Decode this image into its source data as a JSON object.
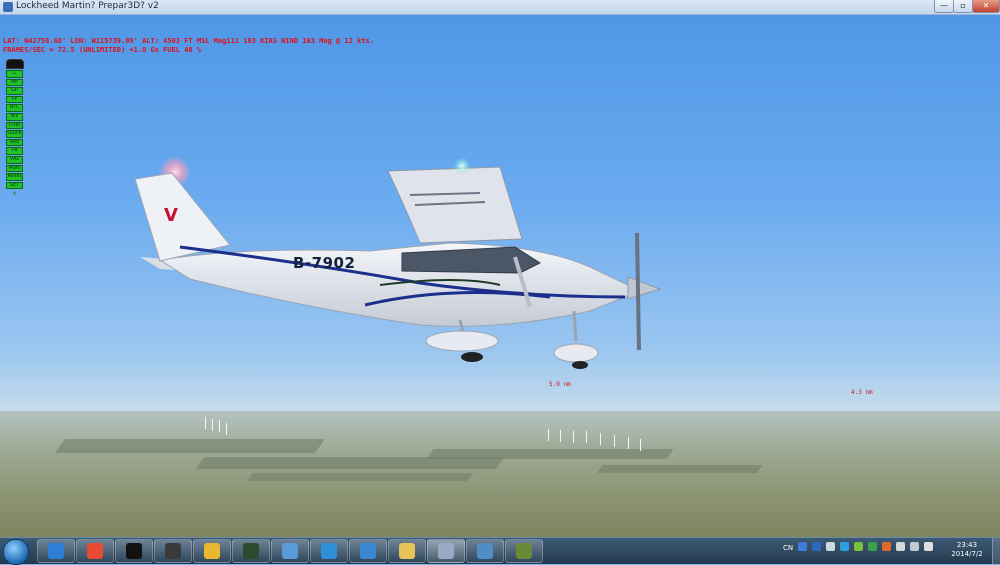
{
  "window": {
    "title": "Lockheed Martin? Prepar3D? v2",
    "min_glyph": "—",
    "max_glyph": "▫",
    "close_glyph": "✕"
  },
  "hud": {
    "line1": "LAT: N42758.68'  LON: W115739.89'  ALT: 4503 FT  MSL   Mag111  103 KIAS  WIND 103 Mag @ 12 kts.",
    "line2": "FRAMES/SEC = 72.5   (UNLIMITED)    +1.0 Gs   FUEL 48 %"
  },
  "aircraft": {
    "registration": "B-7902"
  },
  "distances": {
    "d1": "5.9 nm",
    "d2": "4.3 nm"
  },
  "addon_menu": {
    "items": [
      "L",
      "MP",
      "GP",
      "FP",
      "ATC",
      "Wx",
      "Chat",
      "Quick",
      "Red",
      "Pa",
      "VAL",
      "Multi",
      "Reset",
      "SET"
    ],
    "close": "x"
  },
  "taskbar": {
    "apps": [
      {
        "name": "sogou-icon",
        "color": "#2f7fd6"
      },
      {
        "name": "chrome-icon",
        "color": "#e94a35"
      },
      {
        "name": "qq-icon",
        "color": "#111111"
      },
      {
        "name": "media-icon",
        "color": "#3a3a3a"
      },
      {
        "name": "bird-icon",
        "color": "#e8b830"
      },
      {
        "name": "monitor-icon",
        "color": "#2c4b2c"
      },
      {
        "name": "notes-icon",
        "color": "#5a9ad8"
      },
      {
        "name": "camera-icon",
        "color": "#2e8fd8"
      },
      {
        "name": "im-icon",
        "color": "#3a86d4"
      },
      {
        "name": "folder-icon",
        "color": "#e8c458"
      },
      {
        "name": "p3d-icon",
        "color": "#9aaac4"
      },
      {
        "name": "p3d-config-icon",
        "color": "#4e8ec4"
      },
      {
        "name": "aircraft-tool-icon",
        "color": "#6a8a3a"
      }
    ],
    "lang": "CN",
    "time": "23:43",
    "date": "2014/7/2",
    "tray_colors": [
      "#3d7cd8",
      "#2e66c0",
      "#cfd8e0",
      "#2aa0e0",
      "#7bbf3a",
      "#3aa04a",
      "#e06a2a",
      "#d8d8d8",
      "#c0c8d0",
      "#e0e0e0"
    ]
  }
}
